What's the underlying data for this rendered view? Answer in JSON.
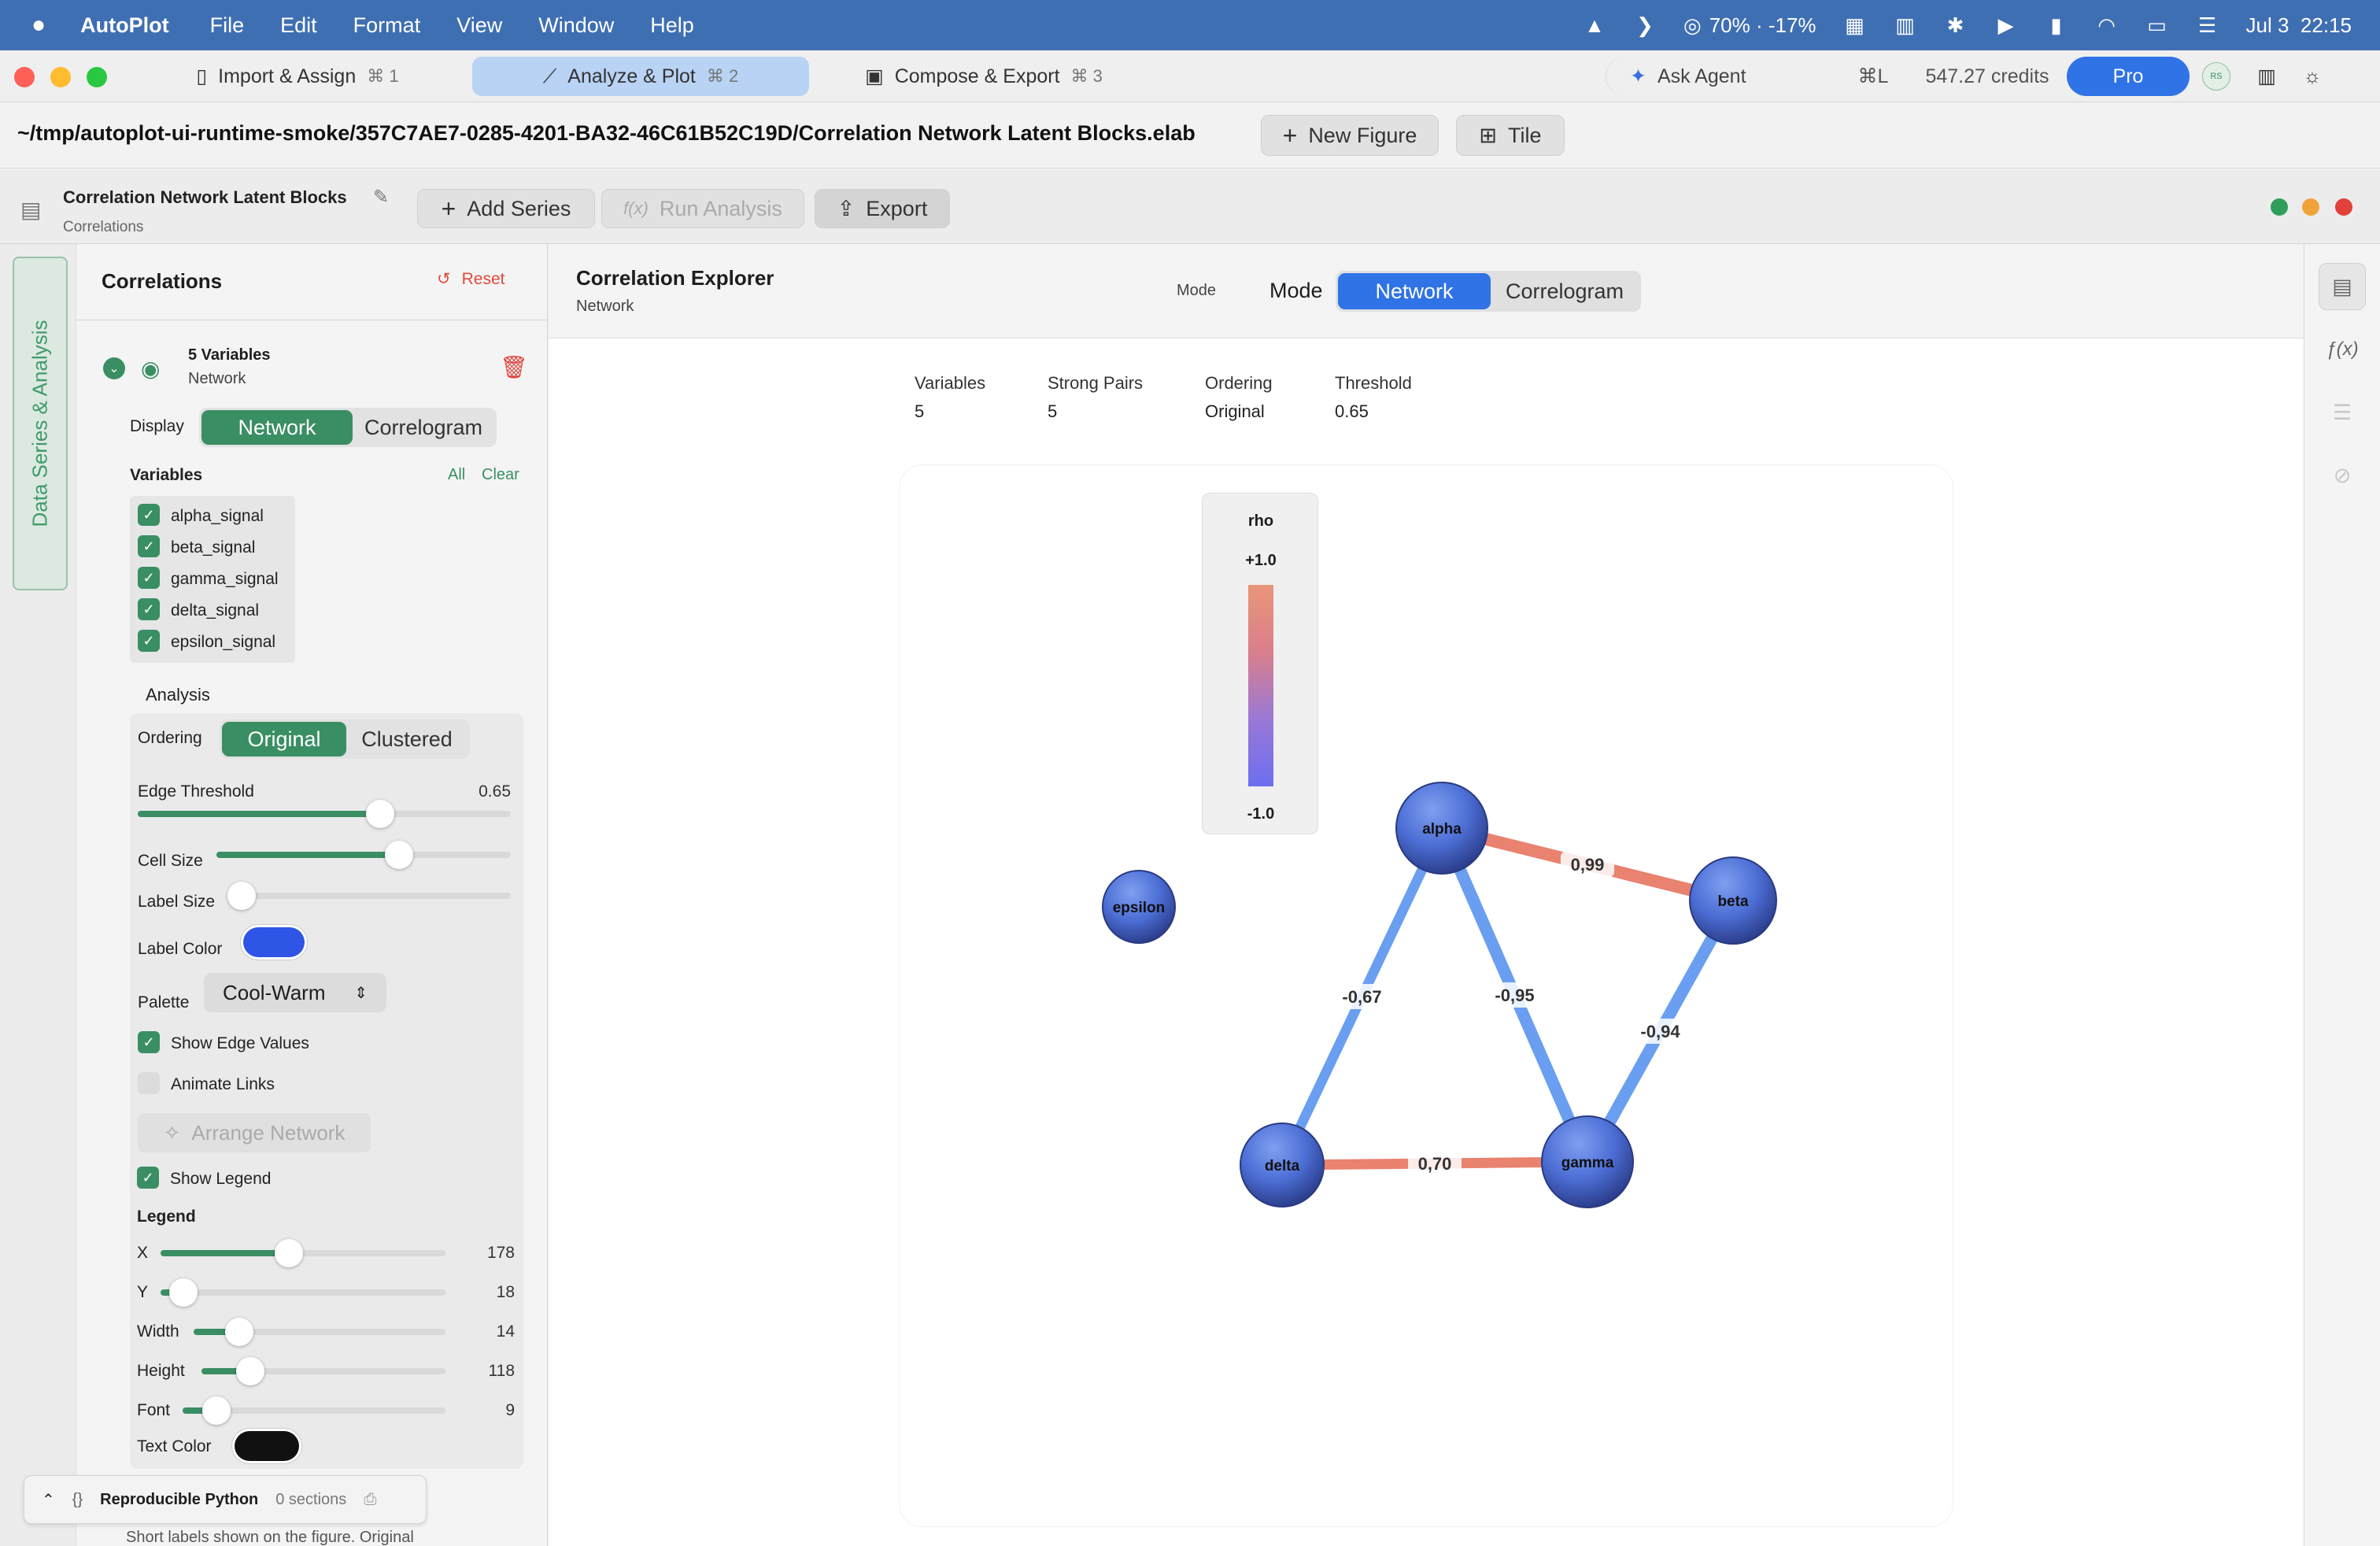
{
  "menubar": {
    "app": "AutoPlot",
    "items": [
      "File",
      "Edit",
      "Format",
      "View",
      "Window",
      "Help"
    ],
    "battery": "70% · -17%",
    "date": "Jul 3",
    "time": "22:15"
  },
  "tabs": [
    {
      "label": "Import & Assign",
      "kbd": "⌘ 1"
    },
    {
      "label": "Analyze & Plot",
      "kbd": "⌘ 2"
    },
    {
      "label": "Compose & Export",
      "kbd": "⌘ 3"
    }
  ],
  "topright": {
    "ask_agent": "Ask Agent",
    "shortcut": "⌘L",
    "credits": "547.27 credits",
    "pro": "Pro",
    "avatar": "RS"
  },
  "pathbar": {
    "path": "~/tmp/autoplot-ui-runtime-smoke/357C7AE7-0285-4201-BA32-46C61B52C19D/Correlation Network Latent Blocks.elab",
    "new_figure": "New Figure",
    "tile": "Tile"
  },
  "toolbar": {
    "doc_title": "Correlation Network Latent Blocks",
    "doc_sub": "Correlations",
    "add_series": "Add Series",
    "run_analysis": "Run Analysis",
    "export": "Export"
  },
  "sidebar": {
    "tab_label": "Data Series & Analysis"
  },
  "panel": {
    "title": "Correlations",
    "reset": "Reset",
    "series_title": "5 Variables",
    "series_sub": "Network",
    "display_label": "Display",
    "display_options": [
      "Network",
      "Correlogram"
    ],
    "variables_label": "Variables",
    "all": "All",
    "clear": "Clear",
    "variables": [
      "alpha_signal",
      "beta_signal",
      "gamma_signal",
      "delta_signal",
      "epsilon_signal"
    ],
    "analysis_label": "Analysis",
    "ordering_label": "Ordering",
    "ordering_options": [
      "Original",
      "Clustered"
    ],
    "edge_threshold_label": "Edge Threshold",
    "edge_threshold": "0.65",
    "edge_threshold_level": 0.65,
    "cell_size_label": "Cell Size",
    "cell_size_level": 0.62,
    "label_size_label": "Label Size",
    "label_size_level": 0.05,
    "label_color_label": "Label Color",
    "label_color": "#2f55e6",
    "palette_label": "Palette",
    "palette": "Cool-Warm",
    "show_edge_values": "Show Edge Values",
    "animate_links": "Animate Links",
    "arrange_network": "Arrange Network",
    "show_legend": "Show Legend",
    "legend_label": "Legend",
    "legend_params": [
      {
        "label": "X",
        "value": "178",
        "level": 0.45
      },
      {
        "label": "Y",
        "value": "18",
        "level": 0.08
      },
      {
        "label": "Width",
        "value": "14",
        "level": 0.18
      },
      {
        "label": "Height",
        "value": "118",
        "level": 0.2
      },
      {
        "label": "Font",
        "value": "9",
        "level": 0.13
      }
    ],
    "text_color_label": "Text Color",
    "text_color": "#111111",
    "repro": "Reproducible Python",
    "repro_sections": "0 sections",
    "footer_text": "Short labels shown on the figure. Original"
  },
  "main": {
    "title": "Correlation Explorer",
    "subtitle": "Network",
    "mode_small": "Mode",
    "mode_label": "Mode",
    "mode_options": [
      "Network",
      "Correlogram"
    ],
    "stats": [
      {
        "k": "Variables",
        "v": "5"
      },
      {
        "k": "Strong Pairs",
        "v": "5"
      },
      {
        "k": "Ordering",
        "v": "Original"
      },
      {
        "k": "Threshold",
        "v": "0.65"
      }
    ],
    "legend": {
      "title": "rho",
      "top": "+1.0",
      "bottom": "-1.0"
    }
  },
  "colors": {
    "accent_green": "#3a8e63",
    "accent_blue": "#2f73e6",
    "positive": "#e9826f",
    "negative": "#6a9ef0"
  },
  "chart_data": {
    "type": "network",
    "nodes": [
      "alpha",
      "beta",
      "gamma",
      "delta",
      "epsilon"
    ],
    "edges": [
      {
        "source": "alpha",
        "target": "beta",
        "rho": 0.99,
        "label": "0,99"
      },
      {
        "source": "alpha",
        "target": "delta",
        "rho": -0.67,
        "label": "-0,67"
      },
      {
        "source": "alpha",
        "target": "gamma",
        "rho": -0.95,
        "label": "-0,95"
      },
      {
        "source": "beta",
        "target": "gamma",
        "rho": -0.94,
        "label": "-0,94"
      },
      {
        "source": "delta",
        "target": "gamma",
        "rho": 0.7,
        "label": "0,70"
      }
    ],
    "colorbar": {
      "min": -1.0,
      "max": 1.0,
      "palette": "Cool-Warm"
    },
    "threshold": 0.65
  }
}
